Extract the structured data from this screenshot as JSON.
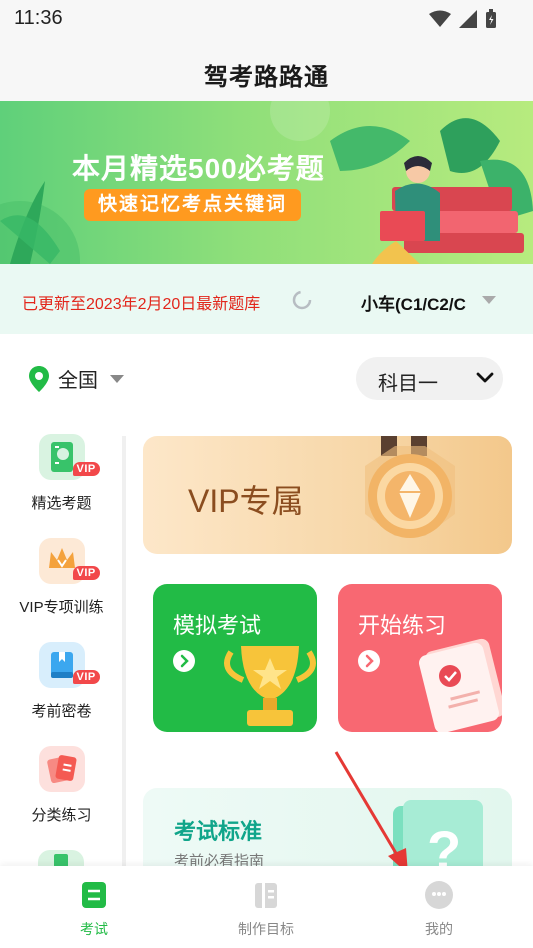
{
  "status_bar": {
    "time": "11:36"
  },
  "header": {
    "title": "驾考路路通"
  },
  "banner": {
    "headline": "本月精选500必考题",
    "subheadline": "快速记忆考点关键词"
  },
  "update_bar": {
    "text": "已更新至2023年2月20日最新题库",
    "vehicle_type": "小车(C1/C2/C"
  },
  "filters": {
    "region": "全国",
    "subject": "科目一"
  },
  "sidebar": {
    "vip_tag": "VIP",
    "items": [
      {
        "label": "精选考题",
        "icon": "checklist-icon",
        "color": "#38c36a"
      },
      {
        "label": "VIP专项训练",
        "icon": "crown-icon",
        "color": "#f4a23d"
      },
      {
        "label": "考前密卷",
        "icon": "book-icon",
        "color": "#3ba7ef"
      },
      {
        "label": "分类练习",
        "icon": "cards-icon",
        "color": "#f45a52"
      }
    ]
  },
  "main": {
    "vip_card": {
      "label": "VIP专属"
    },
    "mock_exam": {
      "label": "模拟考试"
    },
    "start_practice": {
      "label": "开始练习"
    },
    "exam_standard": {
      "title": "考试标准",
      "subtitle": "考前必看指南"
    }
  },
  "bottom_nav": {
    "tabs": [
      {
        "label": "考试",
        "active": true
      },
      {
        "label": "制作目标",
        "active": false
      },
      {
        "label": "我的",
        "active": false
      }
    ]
  },
  "colors": {
    "brand_green": "#22bb46",
    "accent_red": "#f86872",
    "update_red": "#e2261b"
  }
}
